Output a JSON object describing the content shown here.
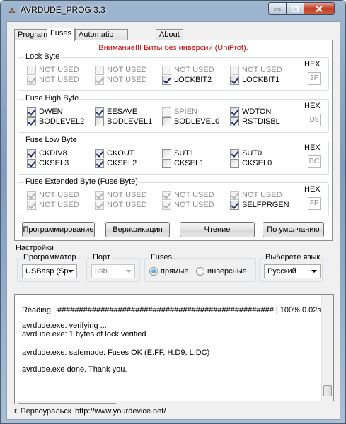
{
  "window": {
    "title": "AVRDUDE_PROG 3.3"
  },
  "tabs": [
    "Program",
    "Fuses",
    "Automatic programming",
    "About"
  ],
  "warning": "Внимание!!! Биты без инверсии (UniProf).",
  "hex_label": "HEX",
  "lock": {
    "title": "Lock Byte",
    "hex": "3F",
    "bits": [
      {
        "label": "NOT USED",
        "checked": false,
        "disabled": true
      },
      {
        "label": "NOT USED",
        "checked": false,
        "disabled": true
      },
      {
        "label": "NOT USED",
        "checked": false,
        "disabled": true
      },
      {
        "label": "NOT USED",
        "checked": false,
        "disabled": true
      },
      {
        "label": "NOT USED",
        "checked": true,
        "disabled": true
      },
      {
        "label": "NOT USED",
        "checked": true,
        "disabled": true
      },
      {
        "label": "LOCKBIT2",
        "checked": true,
        "disabled": false
      },
      {
        "label": "LOCKBIT1",
        "checked": true,
        "disabled": false
      }
    ]
  },
  "high": {
    "title": "Fuse High Byte",
    "hex": "D9",
    "bits": [
      {
        "label": "DWEN",
        "checked": true,
        "disabled": false
      },
      {
        "label": "EESAVE",
        "checked": true,
        "disabled": false
      },
      {
        "label": "SPIEN",
        "checked": false,
        "disabled": true
      },
      {
        "label": "WDTON",
        "checked": true,
        "disabled": false
      },
      {
        "label": "BODLEVEL2",
        "checked": true,
        "disabled": false
      },
      {
        "label": "BODLEVEL1",
        "checked": false,
        "disabled": false
      },
      {
        "label": "BODLEVEL0",
        "checked": false,
        "disabled": false
      },
      {
        "label": "RSTDISBL",
        "checked": true,
        "disabled": false
      }
    ]
  },
  "low": {
    "title": "Fuse Low Byte",
    "hex": "DC",
    "bits": [
      {
        "label": "CKDIV8",
        "checked": true,
        "disabled": false
      },
      {
        "label": "CKOUT",
        "checked": true,
        "disabled": false
      },
      {
        "label": "SUT1",
        "checked": false,
        "disabled": false
      },
      {
        "label": "SUT0",
        "checked": true,
        "disabled": false
      },
      {
        "label": "CKSEL3",
        "checked": true,
        "disabled": false
      },
      {
        "label": "CKSEL2",
        "checked": true,
        "disabled": false
      },
      {
        "label": "CKSEL1",
        "checked": false,
        "disabled": false
      },
      {
        "label": "CKSEL0",
        "checked": false,
        "disabled": false
      }
    ]
  },
  "ext": {
    "title": "Fuse Extended Byte (Fuse Byte)",
    "hex": "FF",
    "bits": [
      {
        "label": "NOT USED",
        "checked": true,
        "disabled": true
      },
      {
        "label": "NOT USED",
        "checked": true,
        "disabled": true
      },
      {
        "label": "NOT USED",
        "checked": true,
        "disabled": true
      },
      {
        "label": "NOT USED",
        "checked": true,
        "disabled": true
      },
      {
        "label": "NOT USED",
        "checked": true,
        "disabled": true
      },
      {
        "label": "NOT USED",
        "checked": true,
        "disabled": true
      },
      {
        "label": "NOT USED",
        "checked": true,
        "disabled": true
      },
      {
        "label": "SELFPRGEN",
        "checked": true,
        "disabled": false
      }
    ]
  },
  "buttons": {
    "program": "Программирование",
    "verify": "Верификация",
    "read": "Чтение",
    "default": "По умолчанию"
  },
  "settings": {
    "title": "Настройки",
    "programmer_label": "Программатор",
    "programmer_value": "USBasp (Sp",
    "port_label": "Порт",
    "port_value": "usb",
    "fuses_label": "Fuses",
    "radio_direct": "прямые",
    "radio_inverse": "инверсные",
    "lang_label": "Выберете язык",
    "lang_value": "Русский"
  },
  "log": [
    "Reading | ################################################## | 100% 0.02s",
    "",
    "avrdude.exe: verifying ...",
    "avrdude.exe: 1 bytes of lock verified",
    "",
    "avrdude.exe: safemode: Fuses OK (E:FF, H:D9, L:DC)",
    "",
    "avrdude.exe done.  Thank you."
  ],
  "status": {
    "city": "г. Первоуральск",
    "url": "http://www.yourdevice.net/"
  }
}
